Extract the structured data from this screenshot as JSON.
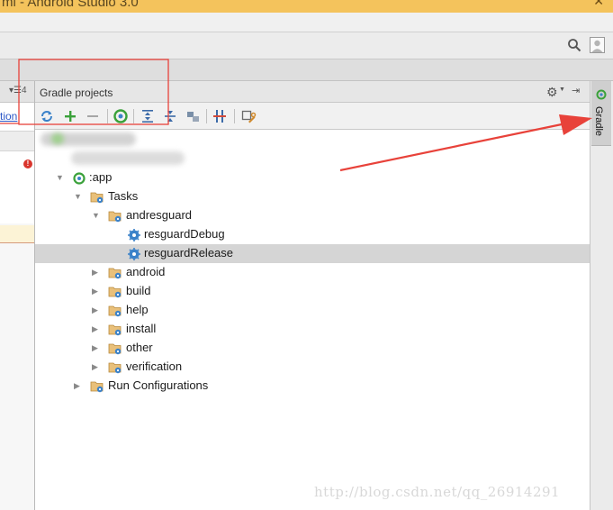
{
  "window": {
    "title": "ml - Android Studio 3.0",
    "close_glyph": "✕"
  },
  "left_panel": {
    "header_control": "▾☰4",
    "link_text": "tion",
    "error_glyph": "!"
  },
  "gradle_panel": {
    "title": "Gradle projects",
    "header_gear": "⚙",
    "header_drop": "▼",
    "header_hide": "⇥",
    "toolbar_icons": [
      "refresh-icon",
      "plus-icon",
      "minus-icon",
      "gradle-elephant-icon",
      "expand-all-icon",
      "collapse-all-icon",
      "link-icon",
      "offline-toggle-icon",
      "settings-wrench-icon"
    ],
    "tree": [
      {
        "label": ":app",
        "arrow": "▼",
        "icon": "module-icon"
      },
      {
        "label": "Tasks",
        "arrow": "▼",
        "icon": "folder-gear-icon"
      },
      {
        "label": "andresguard",
        "arrow": "▼",
        "icon": "folder-gear-icon"
      },
      {
        "label": "resguardDebug",
        "arrow": "",
        "icon": "task-gear-icon"
      },
      {
        "label": "resguardRelease",
        "arrow": "",
        "icon": "task-gear-icon",
        "selected": true
      },
      {
        "label": "android",
        "arrow": "▶",
        "icon": "folder-gear-icon"
      },
      {
        "label": "build",
        "arrow": "▶",
        "icon": "folder-gear-icon"
      },
      {
        "label": "help",
        "arrow": "▶",
        "icon": "folder-gear-icon"
      },
      {
        "label": "install",
        "arrow": "▶",
        "icon": "folder-gear-icon"
      },
      {
        "label": "other",
        "arrow": "▶",
        "icon": "folder-gear-icon"
      },
      {
        "label": "verification",
        "arrow": "▶",
        "icon": "folder-gear-icon"
      },
      {
        "label": "Run Configurations",
        "arrow": "▶",
        "icon": "folder-gear-icon"
      }
    ]
  },
  "side_tab": {
    "label": "Gradle"
  },
  "watermark": "http://blog.csdn.net/qq_26914291",
  "colors": {
    "title_bar": "#f4c35c",
    "annotation_red": "#e8423a",
    "selection": "#d5d5d5",
    "gear_blue": "#3b82c9",
    "gradle_green": "#3aa13a"
  }
}
